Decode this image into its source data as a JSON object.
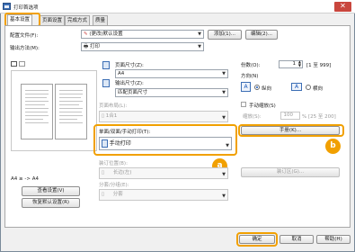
{
  "window": {
    "title": "打印首选项",
    "close_glyph": "✕"
  },
  "tabs": [
    {
      "label": "基本设置",
      "active": true
    },
    {
      "label": "页面设置"
    },
    {
      "label": "完成方式"
    },
    {
      "label": "质量"
    }
  ],
  "left_top": {
    "profile_label": "配置文件(F):",
    "profile_value": "(更改)默认设置",
    "add_button": "添加(1)...",
    "edit_button": "编辑(2)...",
    "output_label": "输出方法(M):",
    "output_value": "打印"
  },
  "preview": {
    "caption": "A4 ≥ -> A4",
    "view_settings_button": "查看设置(V)",
    "restore_defaults_button": "恢复默认设置(R)"
  },
  "page": {
    "page_size_label": "页面尺寸(Z):",
    "page_size_value": "A4",
    "output_size_label": "输出尺寸(Z):",
    "output_size_value": "匹配页面尺寸",
    "page_layout_label": "页面布局(L):",
    "page_layout_value": "1合1"
  },
  "duplex": {
    "label": "单面/双面/手动打印(T):",
    "value": "手动打印",
    "badge": "a"
  },
  "binding": {
    "label": "装订位置(B):",
    "value": "长边(左)",
    "gutter_button": "装订区(G)..."
  },
  "collate": {
    "label": "分套/分组(E):",
    "value": "分套"
  },
  "right": {
    "copies_label": "份数(O):",
    "copies_value": "1",
    "copies_range": "[1 至 999]",
    "orientation_label": "方向(N)",
    "portrait_label": "纵向",
    "landscape_label": "横向",
    "manual_scale_label": "手动缩放(S)",
    "scale_label": "缩放(S):",
    "scale_value": "100",
    "scale_range": "% [25 至 200]",
    "manual_button": "手册(K)...",
    "badge": "b"
  },
  "footer": {
    "ok": "确定",
    "cancel": "取消",
    "help": "帮助(H)"
  },
  "colors": {
    "highlight": "#f1a000",
    "window_bg": "#f0f0f0"
  }
}
